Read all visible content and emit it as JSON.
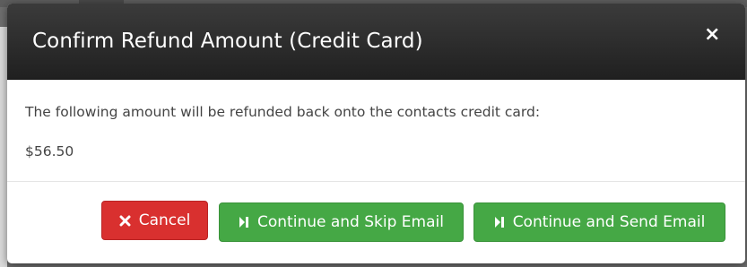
{
  "modal": {
    "title": "Confirm Refund Amount (Credit Card)",
    "close_label": "×",
    "message": "The following amount will be refunded back onto the contacts credit card:",
    "amount": "$56.50"
  },
  "footer": {
    "cancel_label": "Cancel",
    "skip_label": "Continue and Skip Email",
    "send_label": "Continue and Send Email"
  },
  "colors": {
    "header": "#2a2a2a",
    "danger": "#d9302f",
    "success": "#45a845"
  },
  "icons": {
    "cancel": "times-icon",
    "skip": "step-forward-icon",
    "send": "step-forward-icon",
    "close": "close-icon"
  }
}
